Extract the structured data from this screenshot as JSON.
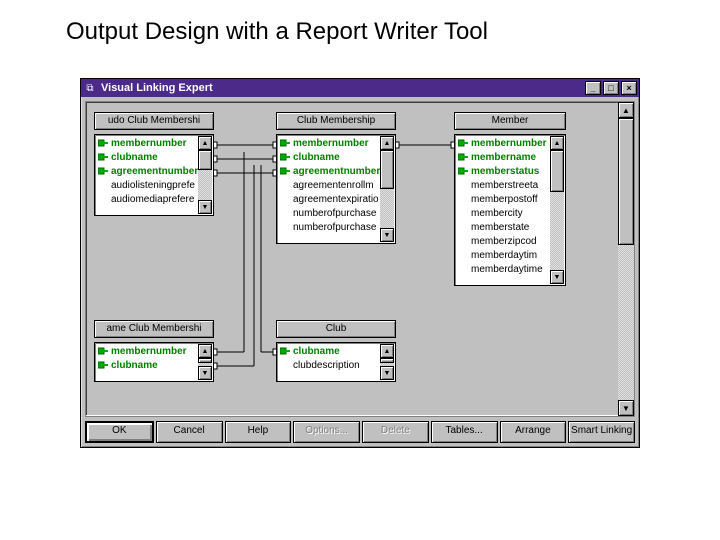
{
  "page_heading": "Output Design with a Report Writer Tool",
  "window": {
    "title": "Visual Linking Expert",
    "controls": {
      "min": "_",
      "max": "□",
      "close": "×"
    }
  },
  "tables": {
    "audio": {
      "title": "udo Club Membershi",
      "fields": [
        {
          "name": "membernumber",
          "key": true
        },
        {
          "name": "clubname",
          "key": true
        },
        {
          "name": "agreementnumber",
          "key": true
        },
        {
          "name": "audiolisteningprefe",
          "key": false
        },
        {
          "name": "audiomediaprefere",
          "key": false
        }
      ]
    },
    "clubmem": {
      "title": "Club Membership",
      "fields": [
        {
          "name": "membernumber",
          "key": true
        },
        {
          "name": "clubname",
          "key": true
        },
        {
          "name": "agreementnumber",
          "key": true
        },
        {
          "name": "agreementenrollm",
          "key": false
        },
        {
          "name": "agreementexpiratio",
          "key": false
        },
        {
          "name": "numberofpurchase",
          "key": false
        },
        {
          "name": "numberofpurchase",
          "key": false
        }
      ]
    },
    "member": {
      "title": "Member",
      "fields": [
        {
          "name": "membernumber",
          "key": true
        },
        {
          "name": "membername",
          "key": true
        },
        {
          "name": "memberstatus",
          "key": true
        },
        {
          "name": "memberstreeta",
          "key": false
        },
        {
          "name": "memberpostoff",
          "key": false
        },
        {
          "name": "membercity",
          "key": false
        },
        {
          "name": "memberstate",
          "key": false
        },
        {
          "name": "memberzipcod",
          "key": false
        },
        {
          "name": "memberdaytim",
          "key": false
        },
        {
          "name": "memberdaytime",
          "key": false
        }
      ]
    },
    "game": {
      "title": "ame Club Membershi",
      "fields": [
        {
          "name": "membernumber",
          "key": true
        },
        {
          "name": "clubname",
          "key": true
        }
      ]
    },
    "club": {
      "title": "Club",
      "fields": [
        {
          "name": "clubname",
          "key": true
        },
        {
          "name": "clubdescription",
          "key": false
        }
      ]
    }
  },
  "buttons": {
    "ok": "OK",
    "cancel": "Cancel",
    "help": "Help",
    "options": "Options...",
    "delete": "Delete",
    "tables": "Tables...",
    "arrange": "Arrange",
    "smart": "Smart Linking"
  }
}
